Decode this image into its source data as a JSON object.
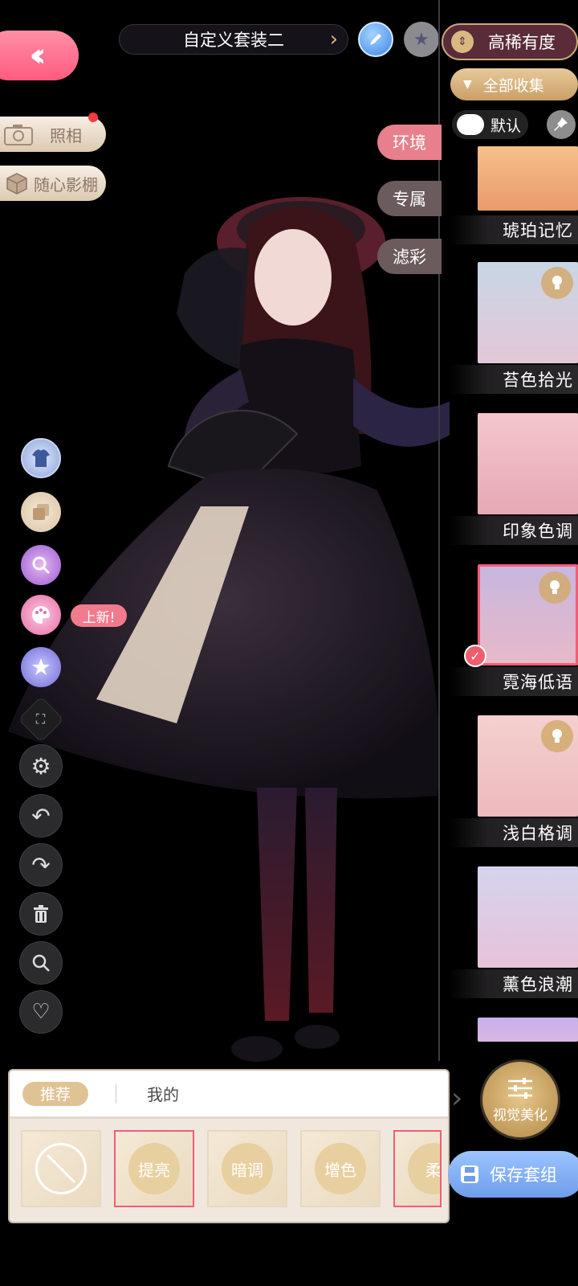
{
  "header": {
    "outfit_title": "自定义套装二",
    "sort_label": "高稀有度",
    "collection_filter_label": "全部收集",
    "default_toggle_label": "默认"
  },
  "left_menu": {
    "photo_label": "照相",
    "studio_label": "随心影棚",
    "new_badge": "上新!"
  },
  "env_tabs": [
    {
      "label": "环境",
      "active": true
    },
    {
      "label": "专属",
      "active": false
    },
    {
      "label": "滤彩",
      "active": false
    }
  ],
  "filters": [
    {
      "name": "琥珀记忆",
      "selected": false
    },
    {
      "name": "苔色拾光",
      "selected": false
    },
    {
      "name": "印象色调",
      "selected": false
    },
    {
      "name": "霓海低语",
      "selected": true
    },
    {
      "name": "浅白格调",
      "selected": false
    },
    {
      "name": "薰色浪潮",
      "selected": false
    }
  ],
  "bottom_panel": {
    "tab_recommended": "推荐",
    "tab_mine": "我的",
    "presets": [
      "",
      "提亮",
      "暗调",
      "增色",
      "柔"
    ]
  },
  "visual_beauty_label": "视觉美化",
  "save_outfit_label": "保存套组",
  "colors": {
    "accent_pink": "#ff5b80",
    "gold": "#d9b981",
    "save_blue": "#7aa7f0"
  }
}
